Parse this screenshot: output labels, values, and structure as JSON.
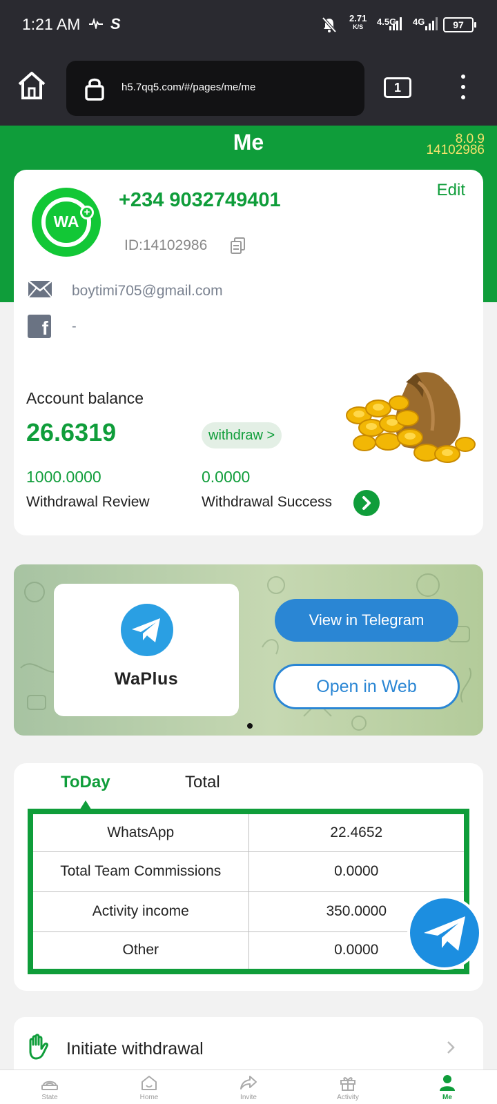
{
  "status_bar": {
    "time": "1:21 AM",
    "net_speed": "2.71",
    "net_unit": "K/S",
    "net1": "4.5G",
    "net2": "4G",
    "battery": "97"
  },
  "browser": {
    "url": "h5.7qq5.com/#/pages/me/me",
    "tab_count": "1"
  },
  "header": {
    "title": "Me",
    "version": "8.0.9",
    "user_code": "14102986"
  },
  "profile": {
    "avatar_text": "WA",
    "phone": "+234 9032749401",
    "edit_label": "Edit",
    "id_label": "ID:14102986",
    "email": "boytimi705@gmail.com",
    "facebook": "-"
  },
  "balance": {
    "label": "Account balance",
    "value": "26.6319",
    "withdraw_label": "withdraw >",
    "review_value": "1000.0000",
    "review_label": "Withdrawal Review",
    "success_value": "0.0000",
    "success_label": "Withdrawal Success"
  },
  "banner": {
    "brand": "WaPlus",
    "view_label": "View in Telegram",
    "open_label": "Open in Web"
  },
  "stats": {
    "tabs": [
      "ToDay",
      "Total"
    ],
    "active_tab": "ToDay",
    "rows": [
      {
        "label": "WhatsApp",
        "value": "22.4652"
      },
      {
        "label": "Total Team Commissions",
        "value": "0.0000"
      },
      {
        "label": "Activity income",
        "value": "350.0000"
      },
      {
        "label": "Other",
        "value": "0.0000"
      }
    ]
  },
  "menu": {
    "withdraw_label": "Initiate withdrawal"
  },
  "nav": {
    "items": [
      {
        "label": "State",
        "icon": "state-icon"
      },
      {
        "label": "Home",
        "icon": "home-icon"
      },
      {
        "label": "Invite",
        "icon": "share-icon"
      },
      {
        "label": "Activity",
        "icon": "gift-icon"
      },
      {
        "label": "Me",
        "icon": "person-icon"
      }
    ],
    "active": "Me"
  },
  "colors": {
    "brand_green": "#0f9d3a",
    "telegram_blue": "#2a86d4",
    "version_yellow": "#f5e26b"
  }
}
